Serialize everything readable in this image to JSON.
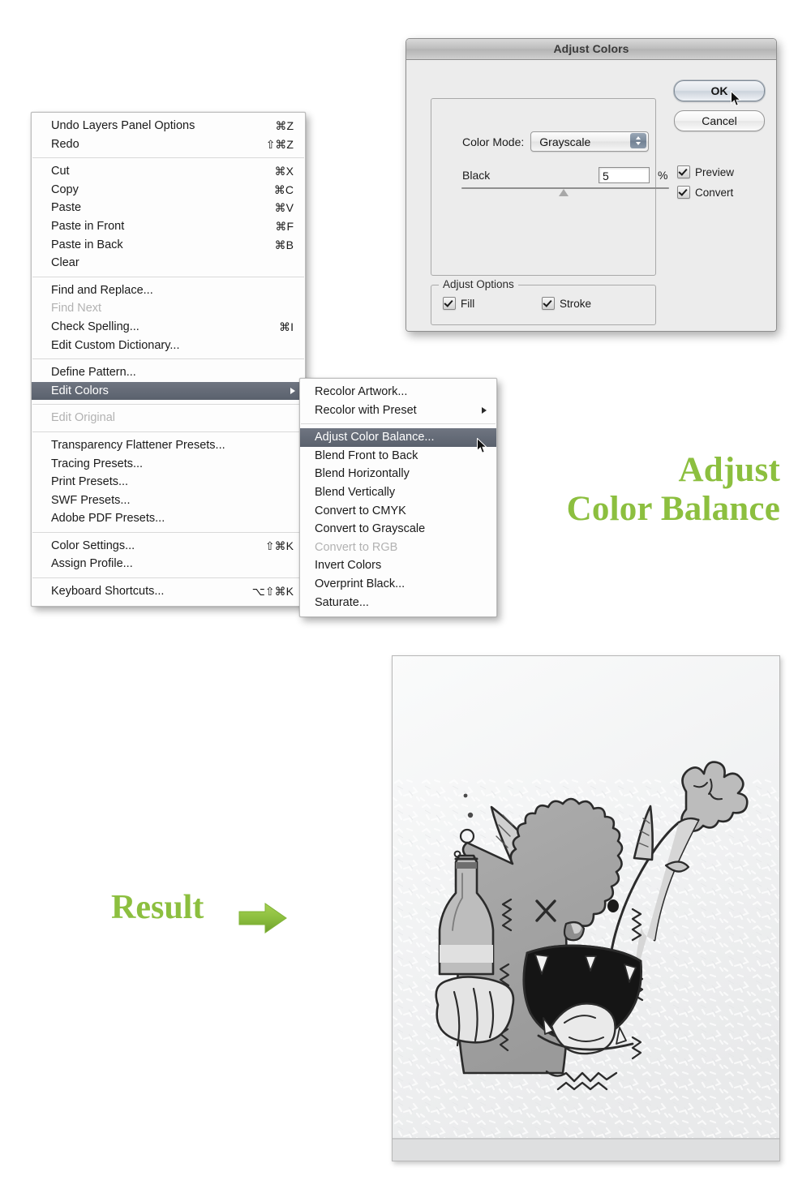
{
  "edit_menu": {
    "groups": [
      [
        {
          "label": "Undo Layers Panel Options",
          "shortcut": "⌘Z",
          "state": "normal"
        },
        {
          "label": "Redo",
          "shortcut": "⇧⌘Z",
          "state": "normal"
        }
      ],
      [
        {
          "label": "Cut",
          "shortcut": "⌘X",
          "state": "normal"
        },
        {
          "label": "Copy",
          "shortcut": "⌘C",
          "state": "normal"
        },
        {
          "label": "Paste",
          "shortcut": "⌘V",
          "state": "normal"
        },
        {
          "label": "Paste in Front",
          "shortcut": "⌘F",
          "state": "normal"
        },
        {
          "label": "Paste in Back",
          "shortcut": "⌘B",
          "state": "normal"
        },
        {
          "label": "Clear",
          "shortcut": "",
          "state": "normal"
        }
      ],
      [
        {
          "label": "Find and Replace...",
          "shortcut": "",
          "state": "normal"
        },
        {
          "label": "Find Next",
          "shortcut": "",
          "state": "disabled"
        },
        {
          "label": "Check Spelling...",
          "shortcut": "⌘I",
          "state": "normal"
        },
        {
          "label": "Edit Custom Dictionary...",
          "shortcut": "",
          "state": "normal"
        }
      ],
      [
        {
          "label": "Define Pattern...",
          "shortcut": "",
          "state": "normal"
        },
        {
          "label": "Edit Colors",
          "shortcut": "",
          "state": "highlighted",
          "submenu": true
        }
      ],
      [
        {
          "label": "Edit Original",
          "shortcut": "",
          "state": "disabled"
        }
      ],
      [
        {
          "label": "Transparency Flattener Presets...",
          "shortcut": "",
          "state": "normal"
        },
        {
          "label": "Tracing Presets...",
          "shortcut": "",
          "state": "normal"
        },
        {
          "label": "Print Presets...",
          "shortcut": "",
          "state": "normal"
        },
        {
          "label": "SWF Presets...",
          "shortcut": "",
          "state": "normal"
        },
        {
          "label": "Adobe PDF Presets...",
          "shortcut": "",
          "state": "normal"
        }
      ],
      [
        {
          "label": "Color Settings...",
          "shortcut": "⇧⌘K",
          "state": "normal"
        },
        {
          "label": "Assign Profile...",
          "shortcut": "",
          "state": "normal"
        }
      ],
      [
        {
          "label": "Keyboard Shortcuts...",
          "shortcut": "⌥⇧⌘K",
          "state": "normal"
        }
      ]
    ]
  },
  "edit_colors_submenu": {
    "groups": [
      [
        {
          "label": "Recolor Artwork...",
          "state": "normal"
        },
        {
          "label": "Recolor with Preset",
          "state": "normal",
          "submenu": true
        }
      ],
      [
        {
          "label": "Adjust Color Balance...",
          "state": "highlighted"
        },
        {
          "label": "Blend Front to Back",
          "state": "normal"
        },
        {
          "label": "Blend Horizontally",
          "state": "normal"
        },
        {
          "label": "Blend Vertically",
          "state": "normal"
        },
        {
          "label": "Convert to CMYK",
          "state": "normal"
        },
        {
          "label": "Convert to Grayscale",
          "state": "normal"
        },
        {
          "label": "Convert to RGB",
          "state": "disabled"
        },
        {
          "label": "Invert Colors",
          "state": "normal"
        },
        {
          "label": "Overprint Black...",
          "state": "normal"
        },
        {
          "label": "Saturate...",
          "state": "normal"
        }
      ]
    ]
  },
  "dialog": {
    "title": "Adjust Colors",
    "color_mode_label": "Color Mode:",
    "color_mode_value": "Grayscale",
    "color_mode_options": [
      "Grayscale"
    ],
    "black_label": "Black",
    "black_value": "5",
    "percent_sign": "%",
    "slider_percent": 5,
    "ok_label": "OK",
    "cancel_label": "Cancel",
    "preview_label": "Preview",
    "preview_checked": true,
    "convert_label": "Convert",
    "convert_checked": true,
    "adjust_options_legend": "Adjust Options",
    "fill_label": "Fill",
    "fill_checked": true,
    "stroke_label": "Stroke",
    "stroke_checked": true
  },
  "annotations": {
    "adjust_line1": "Adjust",
    "adjust_line2": "Color Balance",
    "result_label": "Result",
    "green_accent": "#8cbf3f"
  },
  "artwork": {
    "description": "Grayscale cartoon monster holding a bottle and a club, mouth open",
    "frame_border": "#b7b7b7",
    "background": "#f4f5f6"
  }
}
